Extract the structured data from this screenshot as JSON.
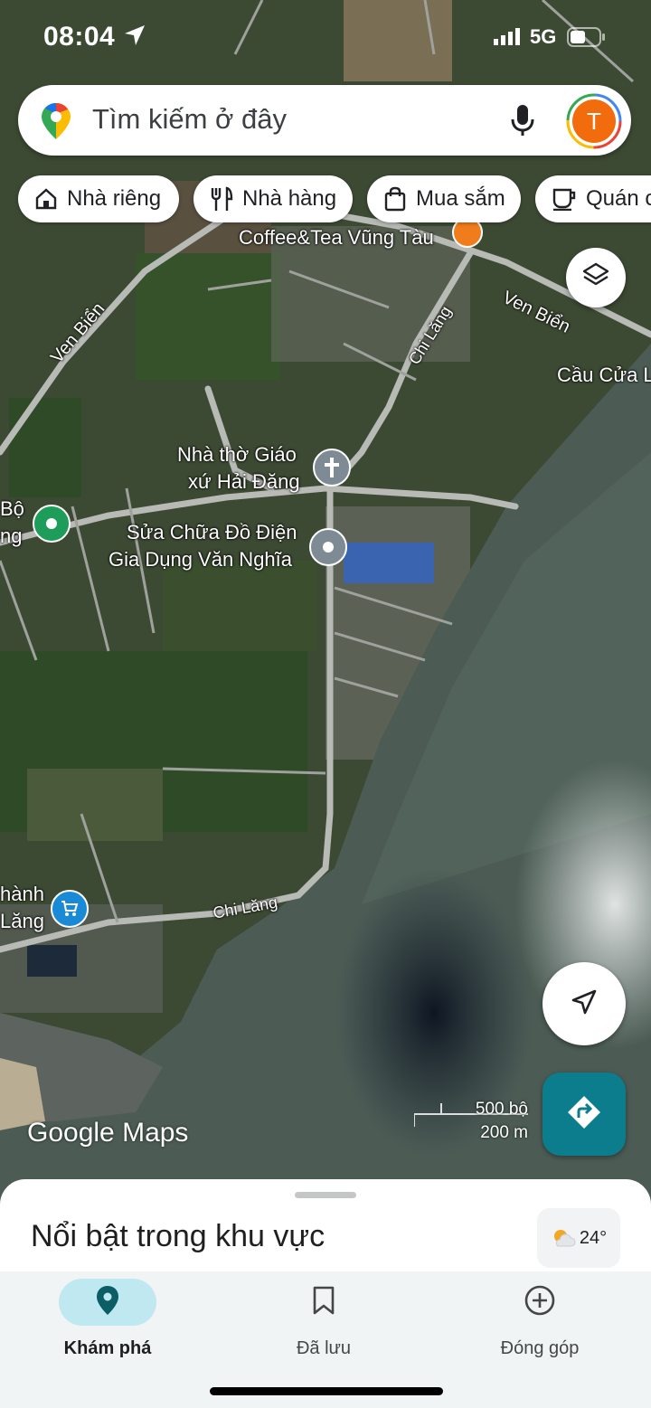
{
  "status": {
    "time": "08:04",
    "network": "5G"
  },
  "search": {
    "placeholder": "Tìm kiếm ở đây",
    "avatar_letter": "T"
  },
  "chips": [
    {
      "label": "Nhà riêng",
      "icon": "home-icon"
    },
    {
      "label": "Nhà hàng",
      "icon": "restaurant-icon"
    },
    {
      "label": "Mua sắm",
      "icon": "shopping-bag-icon"
    },
    {
      "label": "Quán c",
      "icon": "coffee-icon"
    }
  ],
  "map_labels": {
    "coffee": "Coffee&Tea Vũng Tàu",
    "ven_bien_left": "Ven Biển",
    "ven_bien_right": "Ven Biển",
    "chi_lang_top": "Chi Lăng",
    "chi_lang_bottom": "Chi Lăng",
    "cau_cua": "Cầu Cửa L",
    "church_line1": "Nhà thờ Giáo",
    "church_line2": "xứ Hải Đăng",
    "repair_line1": "Sửa Chữa Đồ Điện",
    "repair_line2": "Gia Dụng Văn Nghĩa",
    "bo_line1": "Bộ",
    "bo_line2": "ng",
    "thanh_line1": "hành",
    "thanh_line2": "Lăng"
  },
  "scale": {
    "imperial": "500 bộ",
    "metric": "200 m"
  },
  "logo": "Google Maps",
  "sheet": {
    "title": "Nổi bật trong khu vực",
    "temperature": "24°"
  },
  "nav": [
    {
      "label": "Khám phá",
      "icon": "explore-pin-icon",
      "active": true
    },
    {
      "label": "Đã lưu",
      "icon": "bookmark-icon",
      "active": false
    },
    {
      "label": "Đóng góp",
      "icon": "add-circle-icon",
      "active": false
    }
  ],
  "colors": {
    "accent": "#0b7d8c",
    "active_nav_bg": "#bfe8f0",
    "avatar": "#f26c0d"
  }
}
